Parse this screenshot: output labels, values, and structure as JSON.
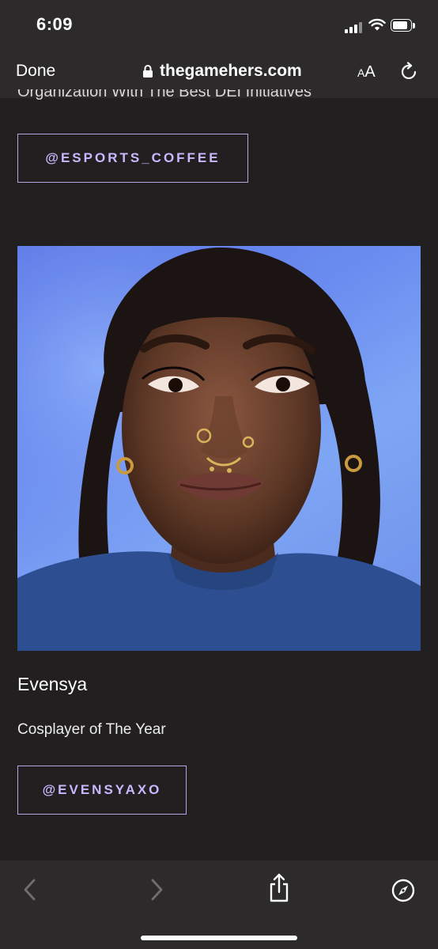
{
  "status": {
    "time": "6:09"
  },
  "browser": {
    "done_label": "Done",
    "url": "thegamehers.com",
    "text_size_label_small": "A",
    "text_size_label_large": "A"
  },
  "content": {
    "cut_off_text": "Organization With The Best DEI Initiatives",
    "first_handle": "@ESPORTS_COFFEE",
    "winner_name": "Evensya",
    "winner_award": "Cosplayer of The Year",
    "winner_handle": "@EVENSYAXO"
  },
  "colors": {
    "background": "#221f20",
    "toolbar": "#2c2a2b",
    "accent": "#b7a6e6"
  },
  "icons": [
    "lock-icon",
    "reload-icon",
    "back-icon",
    "forward-icon",
    "share-icon",
    "compass-icon"
  ]
}
